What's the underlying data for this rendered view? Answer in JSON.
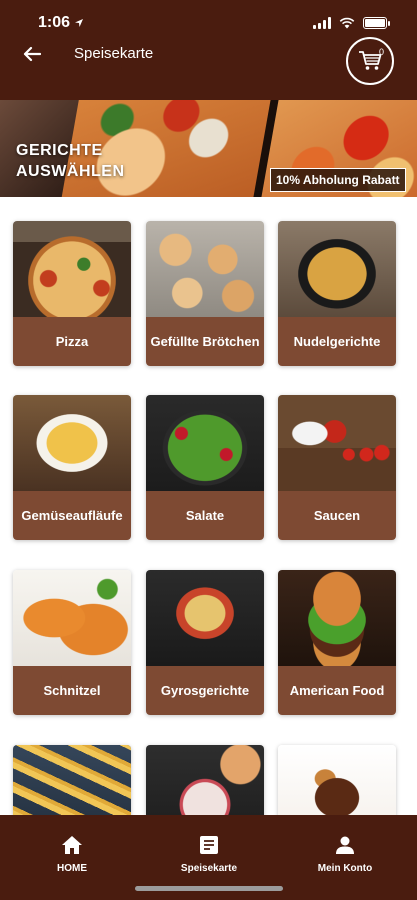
{
  "status_bar": {
    "time": "1:06"
  },
  "header": {
    "title": "Speisekarte",
    "cart_count": "0"
  },
  "banner": {
    "heading": "GERICHTE AUSWÄHLEN",
    "discount": "10% Abholung Rabatt"
  },
  "categories": [
    {
      "label": "Pizza"
    },
    {
      "label": "Gefüllte Brötchen"
    },
    {
      "label": "Nudelgerichte"
    },
    {
      "label": "Gemüseaufläufe"
    },
    {
      "label": "Salate"
    },
    {
      "label": "Saucen"
    },
    {
      "label": "Schnitzel"
    },
    {
      "label": "Gyrosgerichte"
    },
    {
      "label": "American Food"
    }
  ],
  "bottom_nav": {
    "items": [
      {
        "label": "HOME",
        "icon": "home-icon"
      },
      {
        "label": "Speisekarte",
        "icon": "menu-icon"
      },
      {
        "label": "Mein Konto",
        "icon": "account-icon"
      }
    ]
  },
  "colors": {
    "header_bg": "#4a1c0f",
    "card_label_bg": "#7e4a33"
  }
}
